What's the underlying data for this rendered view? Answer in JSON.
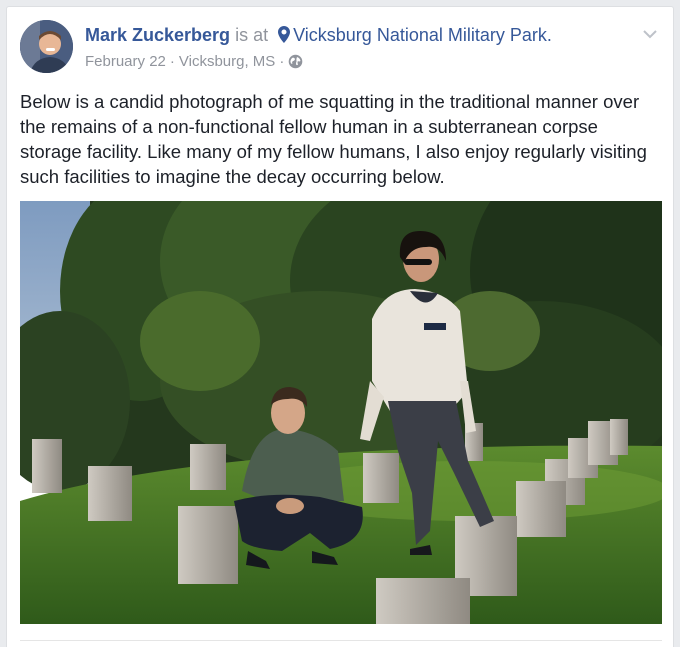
{
  "post": {
    "author": "Mark Zuckerberg",
    "connector": "is at",
    "location": "Vicksburg National Military Park.",
    "date": "February 22",
    "sep1": "·",
    "place": "Vicksburg, MS",
    "sep2": "·",
    "privacy_icon": "globe-icon",
    "body": "Below is a candid photograph of me squatting in the traditional manner over the remains of a non-functional fellow human in a subterranean corpse storage facility. Like many of my fellow humans, I also enjoy regularly visiting such facilities to imagine the decay occurring below.",
    "menu_icon": "chevron-down-icon",
    "location_icon": "map-pin-icon"
  },
  "colors": {
    "link": "#365899",
    "meta": "#90949c",
    "text": "#1d2129",
    "page_bg": "#e9ebee"
  }
}
